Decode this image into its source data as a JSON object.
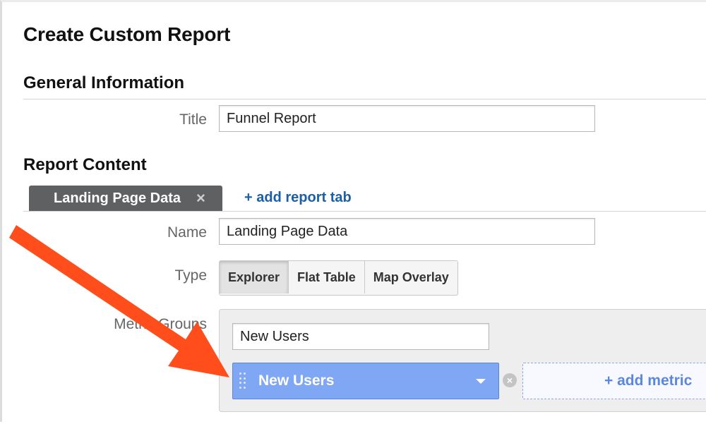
{
  "page": {
    "title": "Create Custom Report"
  },
  "general": {
    "section_title": "General Information",
    "title_label": "Title",
    "title_value": "Funnel Report"
  },
  "content": {
    "section_title": "Report Content",
    "tab": {
      "label": "Landing Page Data",
      "close_glyph": "×"
    },
    "add_tab_label": "+ add report tab",
    "name_label": "Name",
    "name_value": "Landing Page Data",
    "type_label": "Type",
    "type_options": [
      "Explorer",
      "Flat Table",
      "Map Overlay"
    ],
    "type_selected": "Explorer",
    "metric_groups_label": "Metric Groups",
    "metric_group_name": "New Users",
    "metric_chip_label": "New Users",
    "remove_glyph": "×",
    "add_metric_label": "+ add metric"
  },
  "colors": {
    "tab_bg": "#5f6062",
    "link": "#1a5fa8",
    "metric_chip": "#7fa7f3",
    "add_metric_text": "#5c87df",
    "annotation_arrow": "#ff4d1c"
  },
  "icons": {
    "tab_close": "close-icon",
    "chip_drag": "drag-handle-icon",
    "chip_dropdown": "chevron-down-icon",
    "metric_remove": "remove-circle-icon"
  }
}
